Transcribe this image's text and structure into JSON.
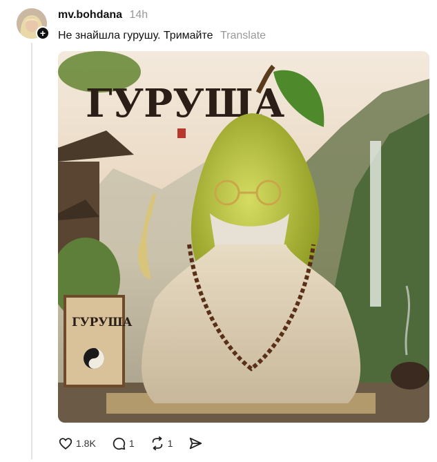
{
  "post": {
    "username": "mv.bohdana",
    "time": "14h",
    "text": "Не знайшла гурушу. Тримайте",
    "translate_label": "Translate",
    "image": {
      "title_text": "ГУРУША",
      "card_text": "ГУРУША"
    }
  },
  "actions": {
    "likes": "1.8K",
    "replies": "1",
    "reposts": "1"
  },
  "colors": {
    "thread_line": "#e3e3e3",
    "muted_text": "#999999",
    "pear": "#b9c23c"
  }
}
